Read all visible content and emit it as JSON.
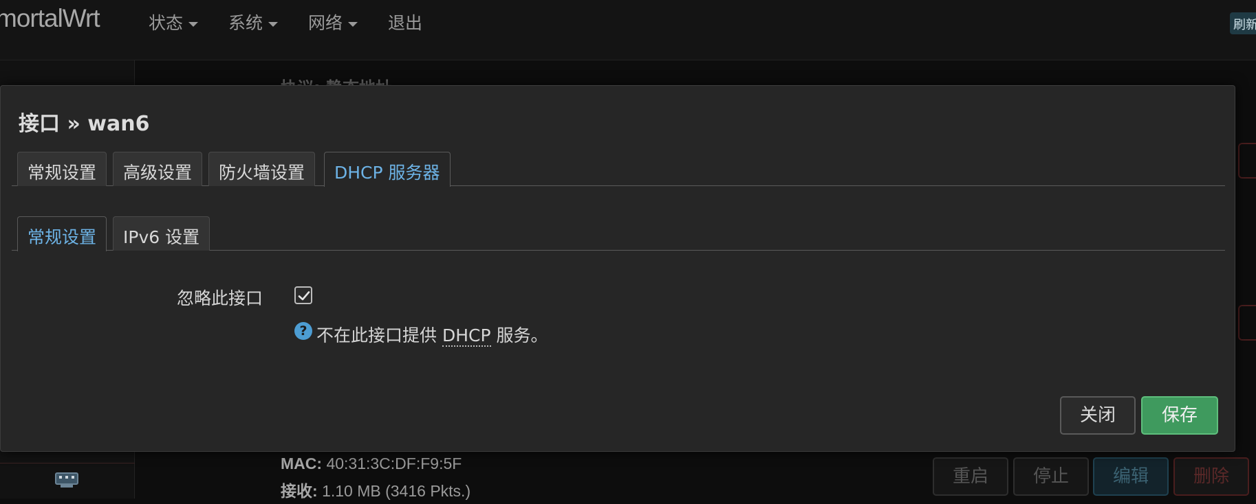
{
  "topbar": {
    "brand": "mortalWrt",
    "nav": [
      "状态",
      "系统",
      "网络",
      "退出"
    ],
    "refresh_label": "刷新"
  },
  "background": {
    "protocol_text": "协议: 静态地址",
    "mac_label": "MAC:",
    "mac_value": "40:31:3C:DF:F9:5F",
    "rx_label": "接收:",
    "rx_value": "1.10 MB (3416 Pkts.)",
    "buttons": [
      "重启",
      "停止",
      "编辑",
      "删除"
    ]
  },
  "modal": {
    "title": "接口 » wan6",
    "tabs": [
      {
        "label": "常规设置",
        "active": false
      },
      {
        "label": "高级设置",
        "active": false
      },
      {
        "label": "防火墙设置",
        "active": false
      },
      {
        "label": "DHCP 服务器",
        "active": true
      }
    ],
    "subtabs": [
      {
        "label": "常规设置",
        "active": true
      },
      {
        "label": "IPv6 设置",
        "active": false
      }
    ],
    "ignore_label": "忽略此接口",
    "ignore_checked": true,
    "help_prefix": "不在此接口提供 ",
    "help_abbr": "DHCP",
    "help_suffix": " 服务。",
    "close_label": "关闭",
    "save_label": "保存"
  },
  "colors": {
    "active_tab": "#6db3e6",
    "save_button": "#3f9a5e",
    "help_icon": "#4d9dd3"
  }
}
